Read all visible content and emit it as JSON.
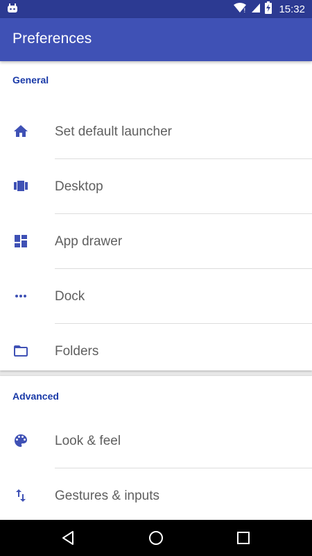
{
  "status_bar": {
    "time": "15:32",
    "icons": [
      "android-icon",
      "wifi-icon",
      "signal-icon",
      "battery-charging-icon"
    ]
  },
  "app_bar": {
    "title": "Preferences"
  },
  "sections": [
    {
      "header": "General",
      "items": [
        {
          "label": "Set default launcher",
          "icon": "home-icon"
        },
        {
          "label": "Desktop",
          "icon": "carousel-icon"
        },
        {
          "label": "App drawer",
          "icon": "dashboard-icon"
        },
        {
          "label": "Dock",
          "icon": "more-horiz-icon"
        },
        {
          "label": "Folders",
          "icon": "folder-icon"
        }
      ]
    },
    {
      "header": "Advanced",
      "items": [
        {
          "label": "Look & feel",
          "icon": "palette-icon"
        },
        {
          "label": "Gestures & inputs",
          "icon": "swap-vert-icon"
        }
      ]
    }
  ],
  "nav_bar": {
    "buttons": [
      "back-icon",
      "home-circle-icon",
      "recents-icon"
    ]
  },
  "colors": {
    "status_bar": "#2c3a92",
    "app_bar": "#3f51b5",
    "accent": "#3f51b5",
    "section_header": "#1a3aa8",
    "item_text": "#5f5f5f",
    "background": "#e8e8e8"
  }
}
